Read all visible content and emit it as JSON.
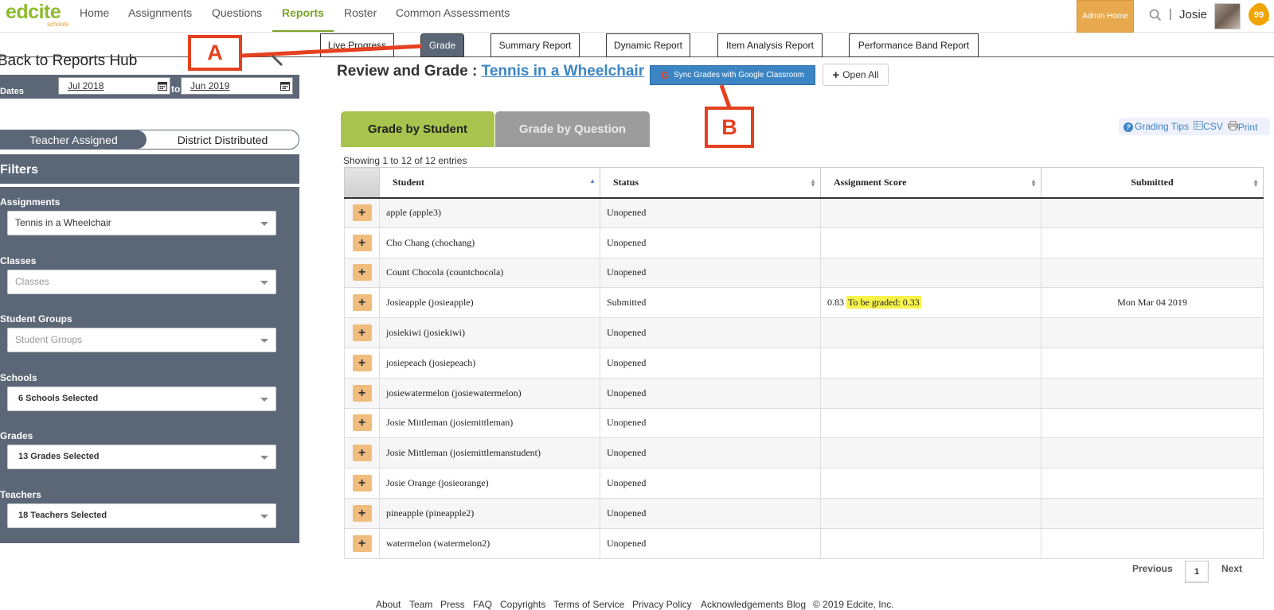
{
  "nav": {
    "logo_word": "edcite",
    "logo_sub": "schools",
    "items": [
      "Home",
      "Assignments",
      "Questions",
      "Reports",
      "Roster",
      "Common Assessments"
    ],
    "admin_home": "Admin Home",
    "separator": "|",
    "user": "Josie",
    "notifications": "99"
  },
  "sidebar": {
    "back": "Back to Reports Hub",
    "dates_label": "Dates",
    "date_from": "Jul 2018",
    "date_to": "Jun 2019",
    "to_label": "to",
    "toggle": [
      "Teacher Assigned",
      "District Distributed"
    ],
    "filters_title": "Filters",
    "filters": [
      {
        "label": "Assignments",
        "value": "Tennis in a Wheelchair"
      },
      {
        "label": "Classes",
        "value": "Classes"
      },
      {
        "label": "Student Groups",
        "value": "Student Groups"
      },
      {
        "label": "Schools",
        "value": "6 Schools Selected"
      },
      {
        "label": "Grades",
        "value": "13 Grades Selected"
      },
      {
        "label": "Teachers",
        "value": "18 Teachers Selected"
      }
    ]
  },
  "report_tabs": [
    "Live Progress",
    "Grade",
    "Summary Report",
    "Dynamic Report",
    "Item Analysis Report",
    "Performance Band Report"
  ],
  "main": {
    "title_prefix": "Review and Grade :",
    "assignment_link": "Tennis in a Wheelchair",
    "sync_icon": "G",
    "sync_label": "Sync Grades with Google Classroom",
    "open_all": "Open All",
    "grade_tabs": [
      "Grade by Student",
      "Grade by Question"
    ],
    "tools": {
      "tips": "Grading Tips",
      "csv": "CSV",
      "print": "Print"
    },
    "showing": "Showing 1 to 12 of 12 entries"
  },
  "table": {
    "headers": [
      "Student",
      "Status",
      "Assignment Score",
      "Submitted"
    ],
    "rows": [
      {
        "student": "apple (apple3)",
        "status": "Unopened",
        "score": "",
        "highlight": "",
        "submitted": ""
      },
      {
        "student": "Cho Chang (chochang)",
        "status": "Unopened",
        "score": "",
        "highlight": "",
        "submitted": ""
      },
      {
        "student": "Count Chocola (countchocola)",
        "status": "Unopened",
        "score": "",
        "highlight": "",
        "submitted": ""
      },
      {
        "student": "Josieapple (josieapple)",
        "status": "Submitted",
        "score": "0.83",
        "highlight": "To be graded: 0.33",
        "submitted": "Mon Mar 04 2019"
      },
      {
        "student": "josiekiwi (josiekiwi)",
        "status": "Unopened",
        "score": "",
        "highlight": "",
        "submitted": ""
      },
      {
        "student": "josiepeach (josiepeach)",
        "status": "Unopened",
        "score": "",
        "highlight": "",
        "submitted": ""
      },
      {
        "student": "josiewatermelon (josiewatermelon)",
        "status": "Unopened",
        "score": "",
        "highlight": "",
        "submitted": ""
      },
      {
        "student": "Josie Mittleman (josiemittleman)",
        "status": "Unopened",
        "score": "",
        "highlight": "",
        "submitted": ""
      },
      {
        "student": "Josie Mittleman (josiemittlemanstudent)",
        "status": "Unopened",
        "score": "",
        "highlight": "",
        "submitted": ""
      },
      {
        "student": "Josie Orange (josieorange)",
        "status": "Unopened",
        "score": "",
        "highlight": "",
        "submitted": ""
      },
      {
        "student": "pineapple (pineapple2)",
        "status": "Unopened",
        "score": "",
        "highlight": "",
        "submitted": ""
      },
      {
        "student": "watermelon (watermelon2)",
        "status": "Unopened",
        "score": "",
        "highlight": "",
        "submitted": ""
      }
    ]
  },
  "pager": {
    "previous": "Previous",
    "page": "1",
    "next": "Next"
  },
  "footer": [
    "About",
    "Team",
    "Press",
    "FAQ",
    "Copyrights",
    "Terms of Service",
    "Privacy Policy",
    "Acknowledgements",
    "Blog",
    "© 2019 Edcite, Inc."
  ],
  "annotations": {
    "a": "A",
    "b": "B"
  },
  "colors": {
    "brand_green": "#8dbb2e",
    "admin_orange": "#e8a94e",
    "sidebar_slate": "#5b6676",
    "link_blue": "#3c85c4",
    "annotation_red": "#e5401f",
    "highlight_yellow": "#f7f34a"
  }
}
